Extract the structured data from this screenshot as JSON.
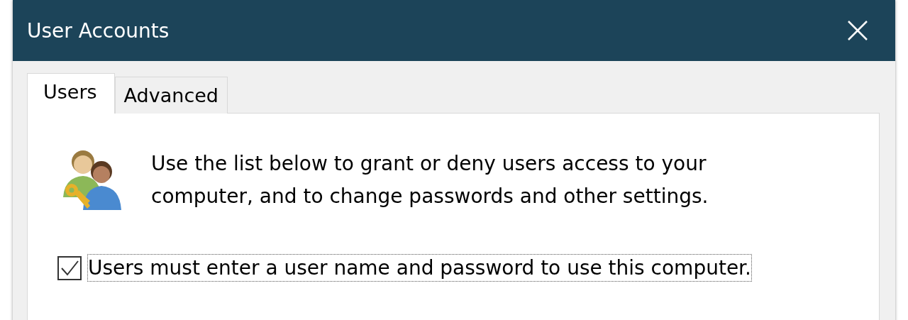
{
  "window": {
    "title": "User Accounts"
  },
  "tabs": [
    {
      "label": "Users",
      "selected": true
    },
    {
      "label": "Advanced",
      "selected": false
    }
  ],
  "description": "Use the list below to grant or deny users access to your computer, and to change passwords and other settings.",
  "require_login": {
    "label": "Users must enter a user name and password to use this computer.",
    "checked": true,
    "focused": true
  }
}
